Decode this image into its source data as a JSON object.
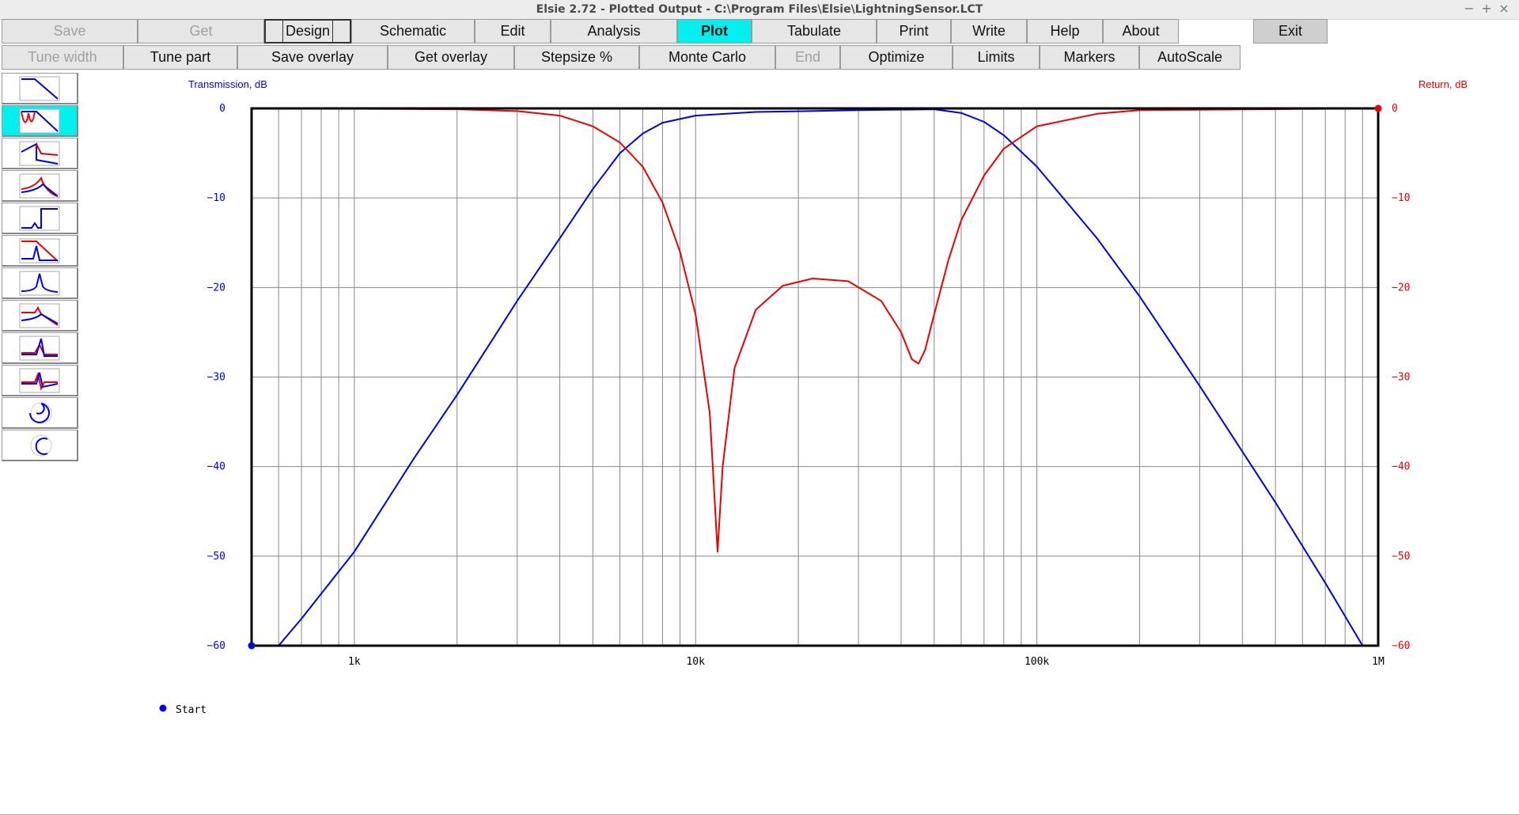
{
  "window": {
    "title": "Elsie 2.72 - Plotted Output - C:\\Program Files\\Elsie\\LightningSensor.LCT",
    "controls": [
      "−",
      "+",
      "×"
    ]
  },
  "toolbar1": [
    {
      "label": "Save",
      "disabled": true
    },
    {
      "label": "Get",
      "disabled": true
    },
    {
      "label": "Design",
      "focused": true
    },
    {
      "label": "Schematic"
    },
    {
      "label": "Edit"
    },
    {
      "label": "Analysis"
    },
    {
      "label": "Plot",
      "active": true
    },
    {
      "label": "Tabulate"
    },
    {
      "label": "Print"
    },
    {
      "label": "Write"
    },
    {
      "label": "Help"
    },
    {
      "label": "About"
    },
    {
      "label": "Exit"
    }
  ],
  "toolbar2": [
    {
      "label": "Tune width",
      "disabled": true
    },
    {
      "label": "Tune part"
    },
    {
      "label": "Save overlay"
    },
    {
      "label": "Get overlay"
    },
    {
      "label": "Stepsize %"
    },
    {
      "label": "Monte Carlo"
    },
    {
      "label": "End",
      "disabled": true
    },
    {
      "label": "Optimize"
    },
    {
      "label": "Limits"
    },
    {
      "label": "Markers"
    },
    {
      "label": "AutoScale"
    }
  ],
  "sidebar": {
    "selected_index": 1,
    "plot_types": [
      "transmission-plot-icon",
      "transmission-return-plot-icon",
      "return-loss-plot-icon",
      "response-peak-plot-icon",
      "step-response-plot-icon",
      "impulse-plot-icon",
      "group-delay-plot-icon",
      "phase-plot-icon",
      "time-response-plot-icon",
      "overlay-plot-icon",
      "smith-chart-input-icon",
      "smith-chart-output-icon"
    ]
  },
  "colors": {
    "transmission": "#0000ee",
    "return": "#ee0000",
    "grid": "#888888",
    "frame": "#000000"
  },
  "chart_data": {
    "type": "line",
    "xscale": "log",
    "xlim": [
      500,
      1000000
    ],
    "xticks": [
      {
        "value": 1000,
        "label": "1k"
      },
      {
        "value": 10000,
        "label": "10k"
      },
      {
        "value": 100000,
        "label": "100k"
      },
      {
        "value": 1000000,
        "label": "1M"
      }
    ],
    "left_axis": {
      "label": "Transmission, dB",
      "lim": [
        -60,
        0
      ],
      "ticks": [
        "0",
        "−10",
        "−20",
        "−30",
        "−40",
        "−50",
        "−60"
      ]
    },
    "right_axis": {
      "label": "Return, dB",
      "lim": [
        -60,
        0
      ],
      "ticks": [
        "0",
        "−10",
        "−20",
        "−30",
        "−40",
        "−50",
        "−60"
      ]
    },
    "grid": true,
    "series": [
      {
        "key": "transmission",
        "axis": "left",
        "points": [
          [
            500,
            -60
          ],
          [
            600,
            -60
          ],
          [
            700,
            -57
          ],
          [
            1000,
            -49.5
          ],
          [
            1500,
            -39
          ],
          [
            2000,
            -32
          ],
          [
            3000,
            -21.5
          ],
          [
            4000,
            -14.5
          ],
          [
            5000,
            -9
          ],
          [
            6000,
            -5
          ],
          [
            7000,
            -2.8
          ],
          [
            8000,
            -1.6
          ],
          [
            10000,
            -0.8
          ],
          [
            15000,
            -0.4
          ],
          [
            30000,
            -0.2
          ],
          [
            50000,
            -0.1
          ],
          [
            60000,
            -0.5
          ],
          [
            70000,
            -1.5
          ],
          [
            80000,
            -3
          ],
          [
            100000,
            -6.5
          ],
          [
            150000,
            -14.5
          ],
          [
            200000,
            -21
          ],
          [
            300000,
            -31
          ],
          [
            500000,
            -44
          ],
          [
            700000,
            -53
          ],
          [
            900000,
            -60
          ],
          [
            1000000,
            -60
          ]
        ]
      },
      {
        "key": "return",
        "axis": "right",
        "points": [
          [
            500,
            0
          ],
          [
            2000,
            -0.1
          ],
          [
            3000,
            -0.3
          ],
          [
            4000,
            -0.8
          ],
          [
            5000,
            -2
          ],
          [
            6000,
            -3.8
          ],
          [
            7000,
            -6.5
          ],
          [
            8000,
            -10.5
          ],
          [
            9000,
            -16
          ],
          [
            10000,
            -23
          ],
          [
            11000,
            -34
          ],
          [
            11600,
            -49.5
          ],
          [
            12000,
            -40
          ],
          [
            13000,
            -29
          ],
          [
            15000,
            -22.5
          ],
          [
            18000,
            -19.8
          ],
          [
            22000,
            -19
          ],
          [
            28000,
            -19.3
          ],
          [
            35000,
            -21.5
          ],
          [
            40000,
            -25
          ],
          [
            43000,
            -28
          ],
          [
            45000,
            -28.5
          ],
          [
            47000,
            -27
          ],
          [
            50000,
            -23
          ],
          [
            55000,
            -17
          ],
          [
            60000,
            -12.5
          ],
          [
            70000,
            -7.5
          ],
          [
            80000,
            -4.5
          ],
          [
            100000,
            -2
          ],
          [
            150000,
            -0.6
          ],
          [
            200000,
            -0.2
          ],
          [
            1000000,
            0
          ]
        ]
      }
    ],
    "legend": [
      {
        "label": "Start",
        "color": "#0000ee"
      }
    ]
  }
}
